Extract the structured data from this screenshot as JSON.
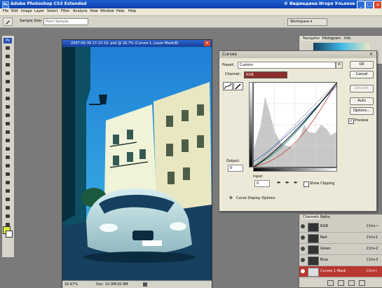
{
  "app": {
    "title": "Adobe Photoshop CS3 Extended",
    "user_label": "© Видмедина Игоря Ульянов",
    "icon_label": "Ps"
  },
  "menu": [
    "File",
    "Edit",
    "Image",
    "Layer",
    "Select",
    "Filter",
    "Analysis",
    "View",
    "Window",
    "Help",
    "Help"
  ],
  "options_bar": {
    "sample_size_label": "Sample Size:",
    "sample_size_value": "Point Sample",
    "workspace_label": "Workspace ▾"
  },
  "document": {
    "title": "2007-05-30  17-22-19 .psd @ 16.7% (Curves 1, Layer Mask/8)",
    "zoom": "16.67%",
    "doc_size": "Doc: 10.0M/20.9M"
  },
  "curves": {
    "title": "Curves",
    "preset_label": "Preset:",
    "preset_value": "Custom",
    "channel_label": "Channel:",
    "channel_value": "RGB",
    "output_label": "Output:",
    "output_value": "0",
    "input_label": "Input:",
    "input_value": "0",
    "show_clipping": "Show Clipping",
    "display_options": "Curve Display Options",
    "buttons": [
      "OK",
      "Cancel",
      "Smooth",
      "Auto",
      "Options..."
    ],
    "preview": "Preview",
    "preview_checked": true
  },
  "panels": {
    "navigator_tabs": [
      "Navigator",
      "Histogram",
      "Info"
    ],
    "channels_tabs": [
      "Channels",
      "Paths"
    ],
    "channels": [
      {
        "name": "RGB",
        "shortcut": "Ctrl+~"
      },
      {
        "name": "Red",
        "shortcut": "Ctrl+1"
      },
      {
        "name": "Green",
        "shortcut": "Ctrl+2"
      },
      {
        "name": "Blue",
        "shortcut": "Ctrl+3"
      },
      {
        "name": "Curves 1 Mask",
        "shortcut": "Ctrl+\\"
      }
    ]
  },
  "colors": {
    "foreground": "#dff234",
    "background": "#ffffff",
    "titlebar": "#0b3fae"
  }
}
